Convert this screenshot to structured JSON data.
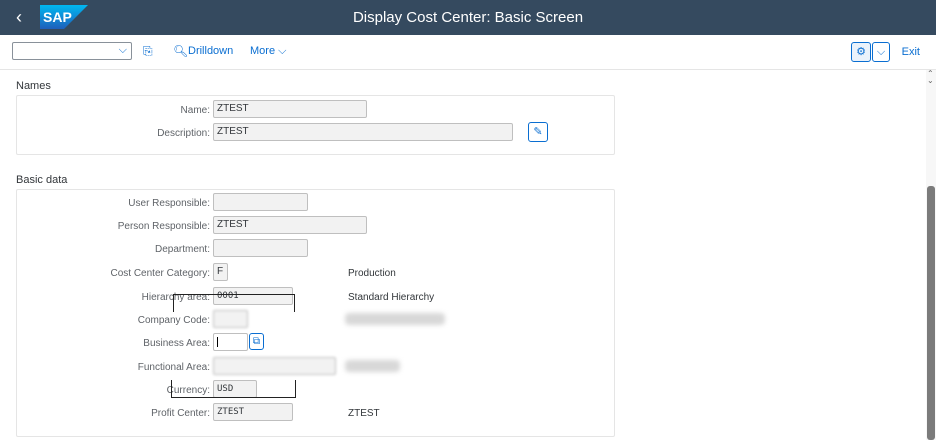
{
  "shell": {
    "back_icon": "chevron-left-icon",
    "logo_text": "SAP",
    "title": "Display Cost Center: Basic Screen"
  },
  "toolbar": {
    "command_field_value": "",
    "drilldown_label": "Drilldown",
    "more_label": "More",
    "exit_label": "Exit"
  },
  "names": {
    "title": "Names",
    "name_label": "Name:",
    "name_value": "ZTEST",
    "description_label": "Description:",
    "description_value": "ZTEST"
  },
  "basic": {
    "title": "Basic data",
    "user_responsible_label": "User Responsible:",
    "user_responsible_value": "",
    "person_responsible_label": "Person Responsible:",
    "person_responsible_value": "ZTEST",
    "department_label": "Department:",
    "department_value": "",
    "category_label": "Cost Center Category:",
    "category_value": "F",
    "category_text": "Production",
    "hierarchy_label": "Hierarchy area:",
    "hierarchy_value": "0001",
    "hierarchy_text": "Standard Hierarchy",
    "company_code_label": "Company Code:",
    "company_code_value": "",
    "business_area_label": "Business Area:",
    "business_area_value": "",
    "functional_area_label": "Functional Area:",
    "functional_area_value": "",
    "currency_label": "Currency:",
    "currency_value": "USD",
    "profit_center_label": "Profit Center:",
    "profit_center_value": "ZTEST",
    "profit_center_text": "ZTEST"
  },
  "colors": {
    "shell": "#354a5f",
    "accent": "#0a6ed1"
  }
}
